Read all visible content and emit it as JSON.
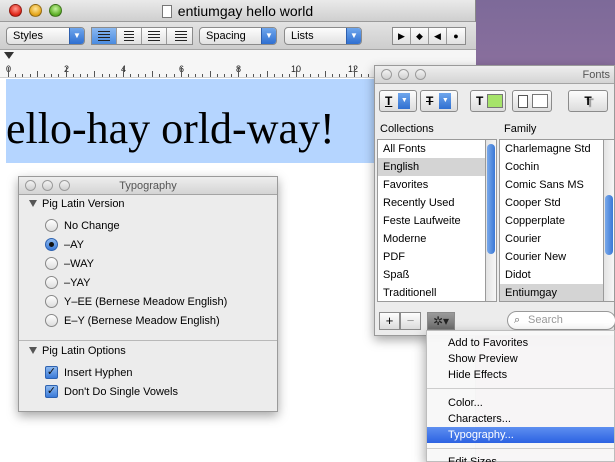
{
  "window": {
    "title": "entiumgay hello world"
  },
  "toolbar": {
    "styles_label": "Styles",
    "spacing_label": "Spacing",
    "lists_label": "Lists"
  },
  "ruler": {
    "numbers": [
      "0",
      "2",
      "4",
      "6",
      "8",
      "10",
      "12"
    ]
  },
  "document": {
    "text": "ello-hay orld-way!"
  },
  "typography_panel": {
    "title": "Typography",
    "version_section": "Pig Latin Version",
    "versions": [
      {
        "label": "No Change",
        "selected": false
      },
      {
        "label": "–AY",
        "selected": true
      },
      {
        "label": "–WAY",
        "selected": false
      },
      {
        "label": "–YAY",
        "selected": false
      },
      {
        "label": "Y–EE (Bernese Meadow English)",
        "selected": false
      },
      {
        "label": "E–Y (Bernese Meadow English)",
        "selected": false
      }
    ],
    "options_section": "Pig Latin Options",
    "options": [
      {
        "label": "Insert Hyphen",
        "checked": true
      },
      {
        "label": "Don't Do Single Vowels",
        "checked": true
      }
    ]
  },
  "fonts_panel": {
    "title": "Fonts",
    "collections_header": "Collections",
    "family_header": "Family",
    "collections": [
      "All Fonts",
      "English",
      "Favorites",
      "Recently Used",
      "Feste Laufweite",
      "Moderne",
      "PDF",
      "Spaß",
      "Traditionell"
    ],
    "selected_collection": "English",
    "families": [
      "Charlemagne Std",
      "Cochin",
      "Comic Sans MS",
      "Cooper Std",
      "Copperplate",
      "Courier",
      "Courier New",
      "Didot",
      "Entiumgay"
    ],
    "selected_family": "Entiumgay",
    "add_label": "+",
    "remove_label": "−",
    "search_placeholder": "Search",
    "text_color": "#a6e36a"
  },
  "action_menu": {
    "items_group1": [
      "Add to Favorites",
      "Show Preview",
      "Hide Effects"
    ],
    "items_group2": [
      "Color...",
      "Characters...",
      "Typography..."
    ],
    "highlighted": "Typography...",
    "items_group3": [
      "Edit Sizes..."
    ]
  },
  "colors": {
    "selection": "#b5d5ff",
    "accent": "#2c62e2"
  }
}
